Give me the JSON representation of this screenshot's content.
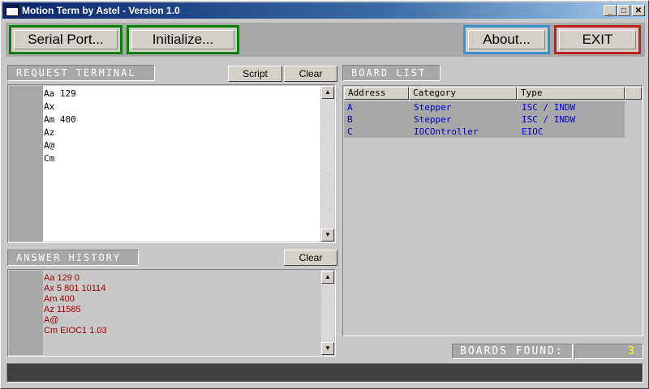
{
  "window": {
    "title": "Motion Term by Astel - Version 1.0",
    "controls": {
      "minimize": "_",
      "maximize": "□",
      "close": "✕"
    }
  },
  "toolbar": {
    "serial_port": "Serial Port...",
    "initialize": "Initialize...",
    "about": "About...",
    "exit": "EXIT"
  },
  "request_terminal": {
    "label": "REQUEST TERMINAL",
    "script_button": "Script",
    "clear_button": "Clear",
    "lines": [
      "Aa 129",
      "Ax",
      "Am 400",
      "Az",
      "A@",
      "Cm"
    ]
  },
  "answer_history": {
    "label": "ANSWER HISTORY",
    "clear_button": "Clear",
    "lines": [
      "Aa 129 0",
      "Ax 5 801 10114",
      "Am 400",
      "Az 11585",
      "A@",
      "Cm EIOC1 1.03"
    ]
  },
  "board_list": {
    "label": "BOARD LIST",
    "columns": [
      "Address",
      "Category",
      "Type"
    ],
    "rows": [
      {
        "address": "A",
        "category": "Stepper",
        "type": "ISC / INDW"
      },
      {
        "address": "B",
        "category": "Stepper",
        "type": "ISC / INDW"
      },
      {
        "address": "C",
        "category": "IOCOntroller",
        "type": "EIOC"
      }
    ]
  },
  "boards_found": {
    "label": "BOARDS FOUND:",
    "value": "3"
  },
  "colors": {
    "title_bar": "#0a246a",
    "serial_border": "#0b7d0b",
    "about_border": "#3a8fd0",
    "exit_border": "#c02020",
    "answer_text": "#990000",
    "board_text": "#0000cc",
    "count_text": "#ffff00"
  },
  "icons": {
    "app": "window-icon",
    "scroll_up": "arrow-up-icon",
    "scroll_down": "arrow-down-icon"
  }
}
